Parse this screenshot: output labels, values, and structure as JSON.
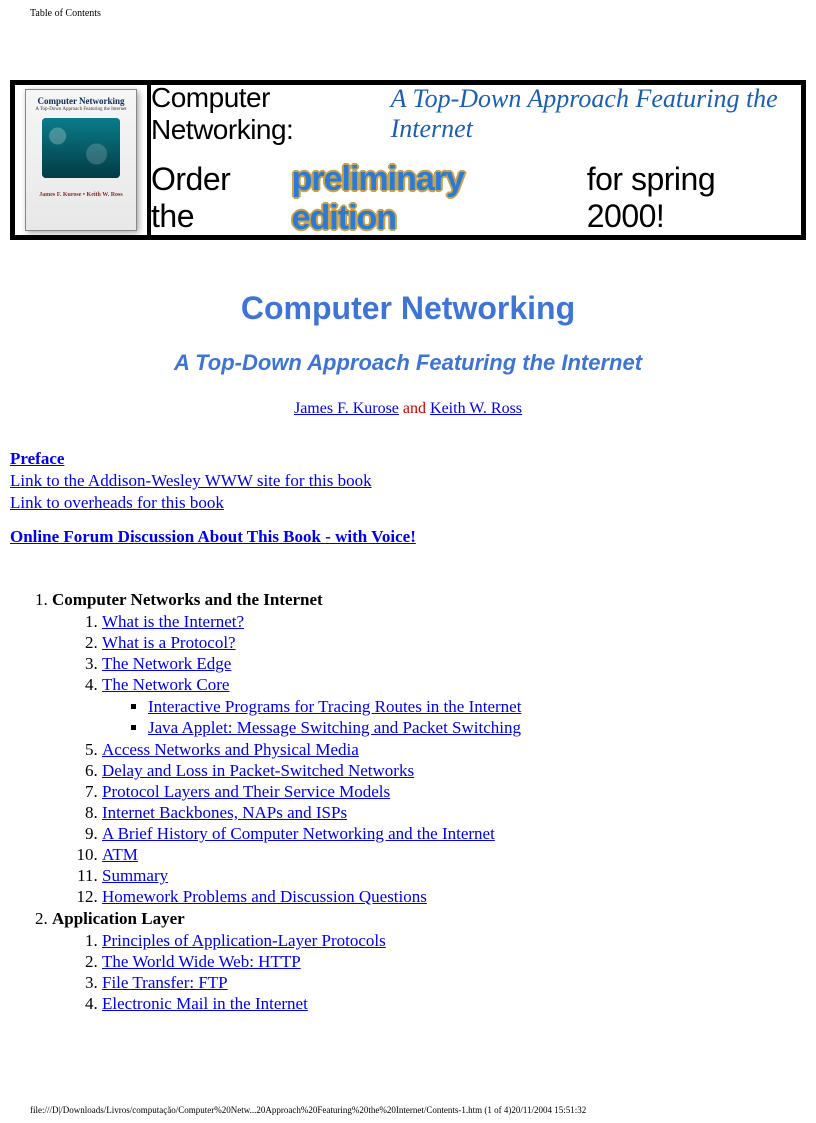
{
  "header_label": "Table of Contents",
  "banner": {
    "book_title": "Computer Networking",
    "book_sub": "A Top-Down Approach Featuring the Internet",
    "book_auth": "James F. Kurose   •   Keith W. Ross",
    "line1_plain": "Computer Networking:",
    "line1_script": "A Top-Down Approach Featuring the Internet",
    "line2_a": "Order the",
    "line2_prelim": "preliminary edition",
    "line2_b": "for spring 2000!"
  },
  "title1": "Computer Networking",
  "title2": "A Top-Down Approach Featuring the Internet",
  "authors": {
    "a1": "James F. Kurose",
    "and": " and ",
    "a2": "Keith W. Ross"
  },
  "links": {
    "preface": "Preface",
    "aw": "Link to the Addison-Wesley WWW site for this book",
    "overheads": "Link to overheads for this book",
    "forum": "Online Forum Discussion About This Book - with Voice!"
  },
  "toc": {
    "ch1": {
      "title": "Computer Networks and the Internet",
      "s1": "What is the Internet?",
      "s2": "What is a Protocol?",
      "s3": "The Network Edge",
      "s4": "The Network Core",
      "s4a": "Interactive Programs for Tracing Routes in the Internet",
      "s4b": "Java Applet: Message Switching and Packet Switching",
      "s5": "Access Networks and Physical Media",
      "s6": "Delay and Loss in Packet-Switched Networks",
      "s7": "Protocol Layers and Their Service Models",
      "s8": "Internet Backbones, NAPs and ISPs",
      "s9": "A Brief History of Computer Networking and the Internet",
      "s10": "ATM",
      "s11": "Summary",
      "s12": "Homework Problems and Discussion Questions"
    },
    "ch2": {
      "title": "Application Layer",
      "s1": "Principles of Application-Layer Protocols",
      "s2": "The World Wide Web: HTTP",
      "s3": "File Transfer: FTP",
      "s4": "Electronic Mail in the Internet"
    }
  },
  "footer": "file:///D|/Downloads/Livros/computação/Computer%20Netw...20Approach%20Featuring%20the%20Internet/Contents-1.htm (1 of 4)20/11/2004 15:51:32"
}
